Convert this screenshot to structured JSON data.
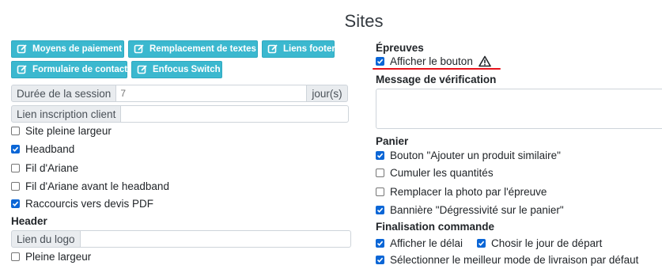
{
  "page_title": "Sites",
  "buttons_row1": [
    {
      "label": "Moyens de paiement"
    },
    {
      "label": "Remplacement de textes"
    },
    {
      "label": "Liens footer"
    }
  ],
  "buttons_row2": [
    {
      "label": "Formulaire de contact"
    },
    {
      "label": "Enfocus Switch"
    }
  ],
  "left": {
    "session": {
      "label": "Durée de la session",
      "placeholder": "7",
      "suffix": "jour(s)"
    },
    "signup": {
      "label": "Lien inscription client",
      "value": ""
    },
    "checks": [
      {
        "label": "Site pleine largeur",
        "checked": false
      },
      {
        "label": "Headband",
        "checked": true
      },
      {
        "label": "Fil d'Ariane",
        "checked": false
      },
      {
        "label": "Fil d'Ariane avant le headband",
        "checked": false
      },
      {
        "label": "Raccourcis vers devis PDF",
        "checked": true
      }
    ],
    "header_section": "Header",
    "logo": {
      "label": "Lien du logo",
      "value": ""
    },
    "header_checks": [
      {
        "label": "Pleine largeur",
        "checked": false
      }
    ]
  },
  "right": {
    "proofs_section": "Épreuves",
    "show_button": {
      "label": "Afficher le bouton",
      "checked": true,
      "icon": "warning-icon"
    },
    "verify_label": "Message de vérification",
    "cart_section": "Panier",
    "cart_checks": [
      {
        "label": "Bouton \"Ajouter un produit similaire\"",
        "checked": true
      },
      {
        "label": "Cumuler les quantités",
        "checked": false
      },
      {
        "label": "Remplacer la photo par l'épreuve",
        "checked": false
      },
      {
        "label": "Bannière \"Dégressivité sur le panier\"",
        "checked": true
      }
    ],
    "finalize_section": "Finalisation commande",
    "finalize_checks": [
      {
        "label": "Afficher le délai",
        "checked": true
      },
      {
        "label": "Chosir le jour de départ",
        "checked": true
      },
      {
        "label": "Sélectionner le meilleur mode de livraison par défaut",
        "checked": true
      }
    ]
  },
  "colors": {
    "button_bg": "#3bb8cf",
    "checkbox_on": "#0b66d6",
    "underline": "#e8121b"
  }
}
